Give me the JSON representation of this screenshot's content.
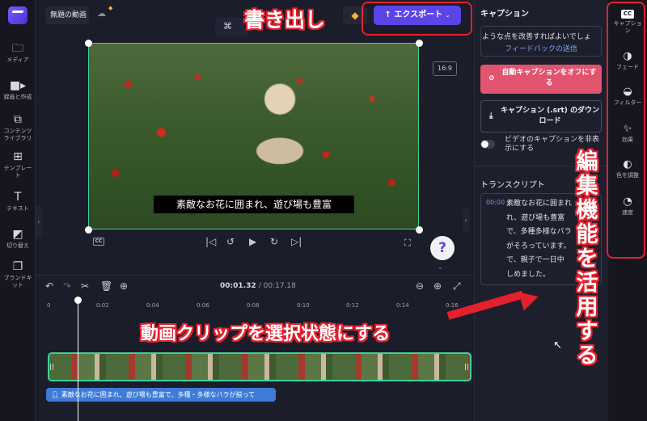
{
  "app": {
    "project_title": "無題の動画"
  },
  "sidebar": {
    "items": [
      {
        "label": "メディア",
        "icon": "folder-icon"
      },
      {
        "label": "録画と作成",
        "icon": "camera-icon"
      },
      {
        "label": "コンテンツライブラリ",
        "icon": "library-icon"
      },
      {
        "label": "テンプレート",
        "icon": "template-icon"
      },
      {
        "label": "テキスト",
        "icon": "text-icon"
      },
      {
        "label": "切り替え",
        "icon": "transition-icon"
      },
      {
        "label": "ブランドキット",
        "icon": "brand-icon"
      }
    ]
  },
  "topbar": {
    "export_label": "エクスポート",
    "crop_icon": "crop-icon"
  },
  "canvas": {
    "aspect_ratio": "16:9",
    "subtitle": "素敵なお花に囲まれ、遊び場も豊富",
    "help_label": "?"
  },
  "timeline": {
    "current_time": "00:01.32",
    "total_time": "/ 00:17.18",
    "ticks": [
      "0",
      "0:02",
      "0:04",
      "0:06",
      "0:08",
      "0:10",
      "0:12",
      "0:14",
      "0:16"
    ],
    "caption_clip": "素敵なお花に囲まれ、遊び場も豊富で、多種・多様なバラが揃って"
  },
  "panel": {
    "title": "キャプション",
    "feedback_question": "ような点を改善すればよいでしょ",
    "feedback_link": "フィードバックの送信",
    "auto_caption_off": "自動キャプションをオフにする",
    "download_srt": "キャプション (.srt) のダウンロード",
    "hide_captions": "ビデオのキャプションを非表示にする",
    "transcript_title": "トランスクリプト",
    "transcript_time": "00:00",
    "transcript_lines": [
      "素敵なお花に囲まれ",
      "れ、遊び場も豊富",
      "で、多種多様なバラ",
      "がそろっています。",
      "で、親子で一日中",
      "しめました。"
    ]
  },
  "tools": [
    {
      "label": "キャプション",
      "icon": "cc-icon"
    },
    {
      "label": "フェード",
      "icon": "fade-icon"
    },
    {
      "label": "フィルター",
      "icon": "filter-icon"
    },
    {
      "label": "効果",
      "icon": "effects-wand-icon"
    },
    {
      "label": "色を調整",
      "icon": "color-adjust-icon"
    },
    {
      "label": "速度",
      "icon": "speed-icon"
    }
  ],
  "annotations": {
    "export_note": "書き出し",
    "select_clip_note": "動画クリップを選択状態にする",
    "edit_tools_note": "編集機能を活用する"
  },
  "colors": {
    "accent": "#5b45e6",
    "annotation_red": "#e5202e",
    "selection": "#3fd19b",
    "caption_track": "#3f7bd8"
  }
}
